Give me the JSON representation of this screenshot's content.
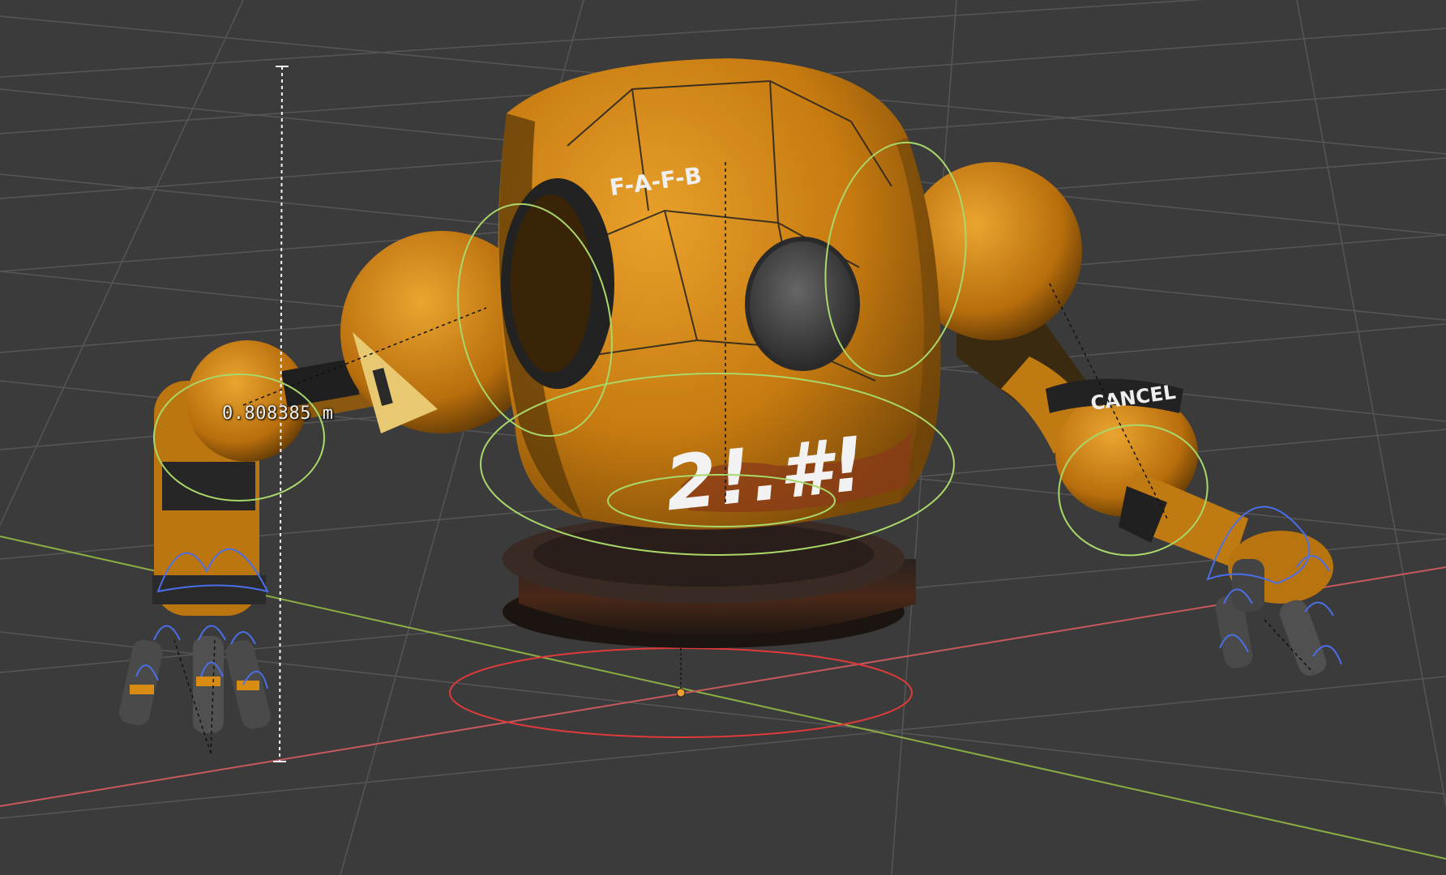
{
  "viewport": {
    "measurement_label": "0.808385 m",
    "head_decal_text": "F-A-F-B",
    "face_graffiti": "2!.#!",
    "arm_decal_text": "CANCEL",
    "colors": {
      "background": "#3b3b3b",
      "grid": "#565656",
      "x_axis": "#c8595d",
      "y_axis": "#8aae44",
      "body_orange": "#d88c14",
      "ik_control": "#a9d86a",
      "finger_control": "#4a6fe8",
      "root_control": "#e03a3a",
      "origin": "#f0a030"
    },
    "icons": [
      "measure-ruler-icon",
      "origin-dot-icon"
    ]
  }
}
